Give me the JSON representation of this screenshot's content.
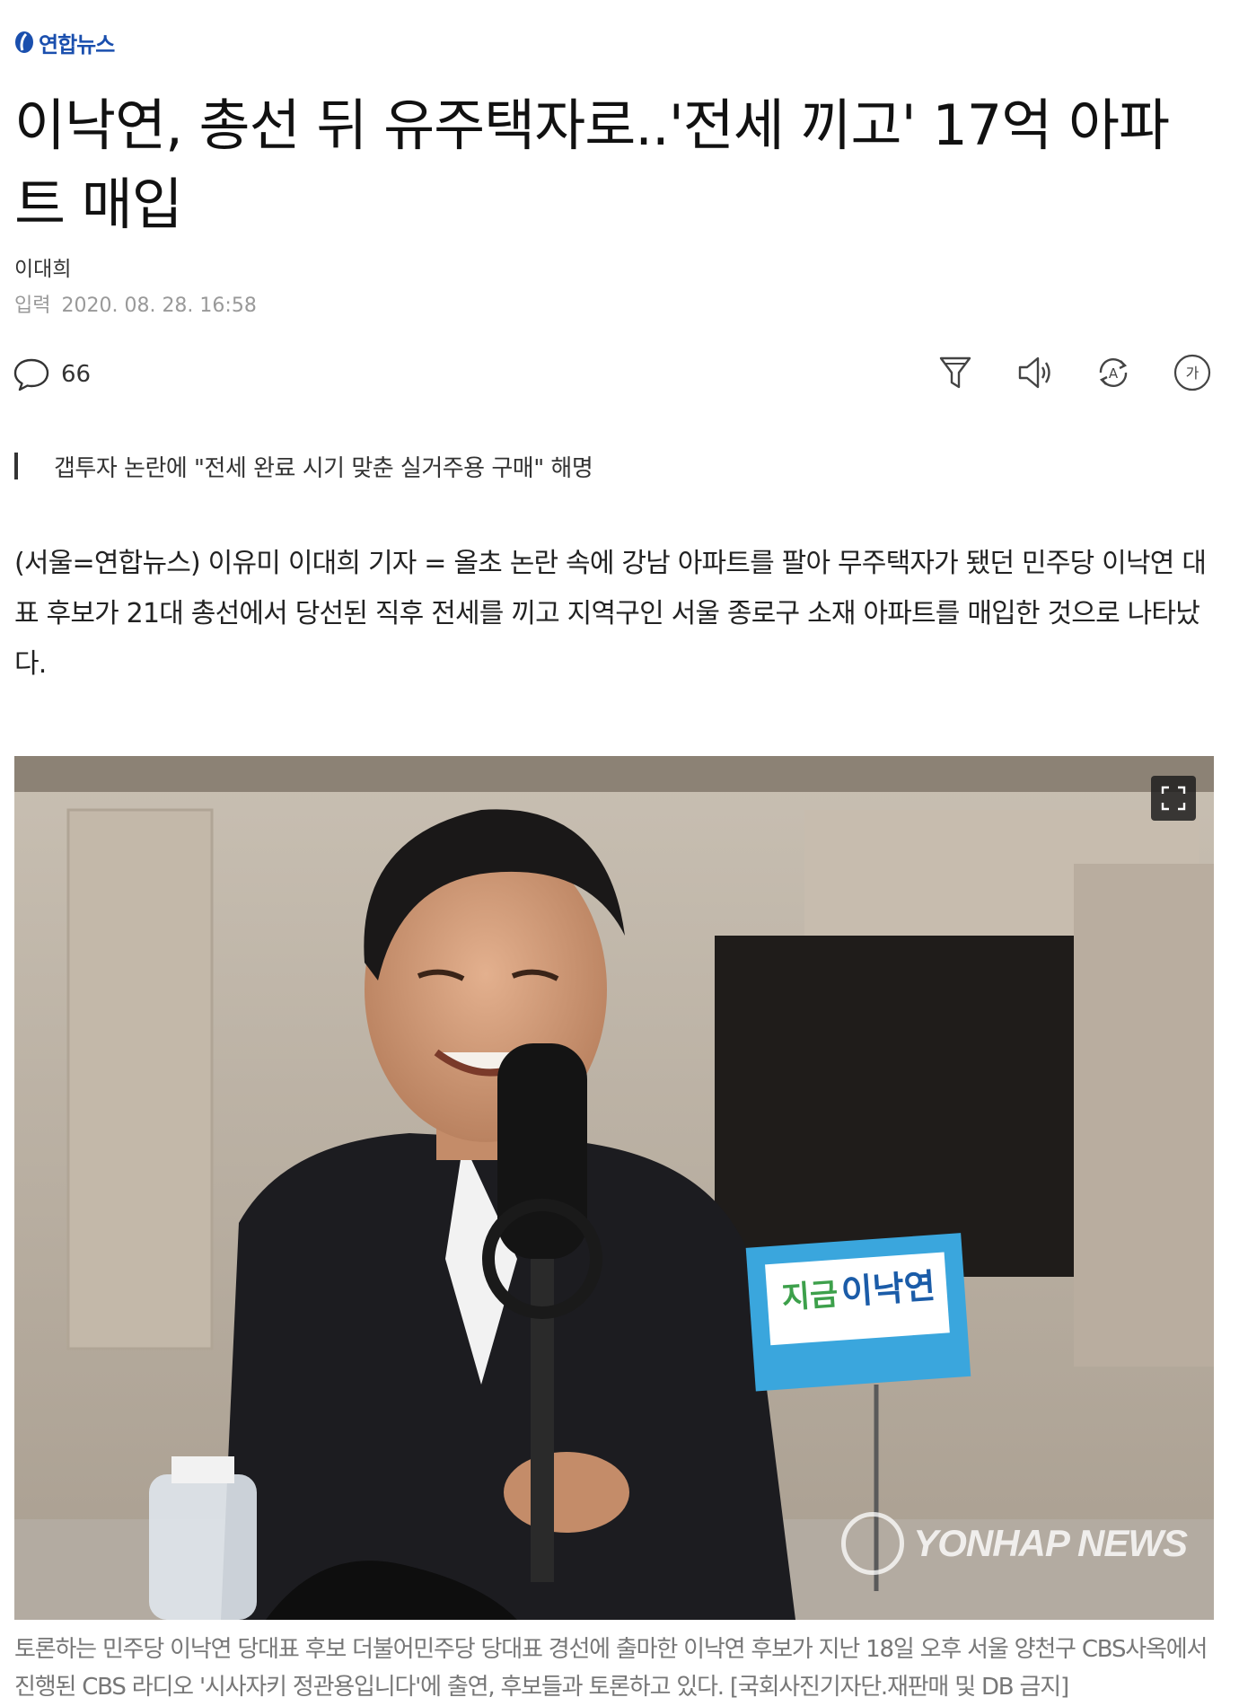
{
  "brand": {
    "name": "연합뉴스",
    "logo_color": "#1a4fae"
  },
  "article": {
    "title": "이낙연, 총선 뒤 유주택자로..'전세 끼고' 17억 아파트 매입",
    "author": "이대희",
    "date_label": "입력",
    "date_value": "2020. 08. 28. 16:58",
    "comment_count": "66",
    "summary": "갭투자 논란에 \"전세 완료 시기 맞춘 실거주용 구매\" 해명",
    "body": "(서울=연합뉴스) 이유미 이대희 기자 = 올초 논란 속에 강남 아파트를 팔아 무주택자가 됐던 민주당 이낙연 대표 후보가 21대 총선에서 당선된 직후 전세를 끼고 지역구인 서울 종로구 소재 아파트를 매입한 것으로 나타났다.",
    "photo": {
      "sign_text_green": "지금",
      "sign_text_blue": "이낙연",
      "watermark": "YONHAP NEWS",
      "caption": "토론하는 민주당 이낙연 당대표 후보 더불어민주당 당대표 경선에 출마한 이낙연 후보가 지난 18일 오후 서울 양천구 CBS사옥에서 진행된 CBS 라디오 '시사자키 정관용입니다'에 출연, 후보들과 토론하고 있다. [국회사진기자단.재판매 및 DB 금지]"
    }
  },
  "toolbar": {
    "icons": [
      "comment-icon",
      "filter-icon",
      "speaker-icon",
      "translate-icon",
      "font-size-icon"
    ],
    "font_size_glyph": "가",
    "translate_glyph": "A"
  }
}
